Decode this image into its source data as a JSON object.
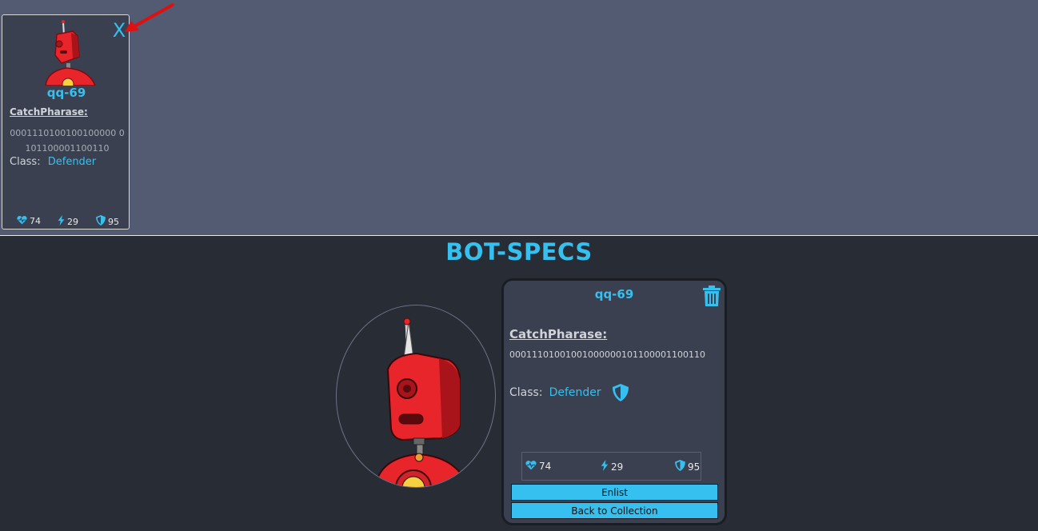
{
  "army": {
    "bot": {
      "name": "qq-69",
      "catchphrase_label": "CatchPharase:",
      "catchphrase": "0001110100100100000 0101100001100110",
      "class_label": "Class:",
      "class": "Defender",
      "health": "74",
      "damage": "29",
      "armor": "95",
      "close_label": "X"
    }
  },
  "specs": {
    "title": "BOT-SPECS",
    "bot": {
      "name": "qq-69",
      "catchphrase_label": "CatchPharase:",
      "catchphrase": "0001110100100100000010110000110011​0",
      "class_label": "Class:",
      "class": "Defender",
      "health": "74",
      "damage": "29",
      "armor": "95"
    },
    "buttons": {
      "enlist": "Enlist",
      "back": "Back to Collection"
    }
  },
  "colors": {
    "accent": "#35c0ef",
    "army_bg": "#525b71",
    "page_bg": "#282c34",
    "card_bg": "#3a4050",
    "robot_red": "#e8252a"
  },
  "icons": [
    "close-icon",
    "trash-icon",
    "heartbeat-icon",
    "bolt-icon",
    "shield-icon",
    "red-arrow-icon"
  ]
}
